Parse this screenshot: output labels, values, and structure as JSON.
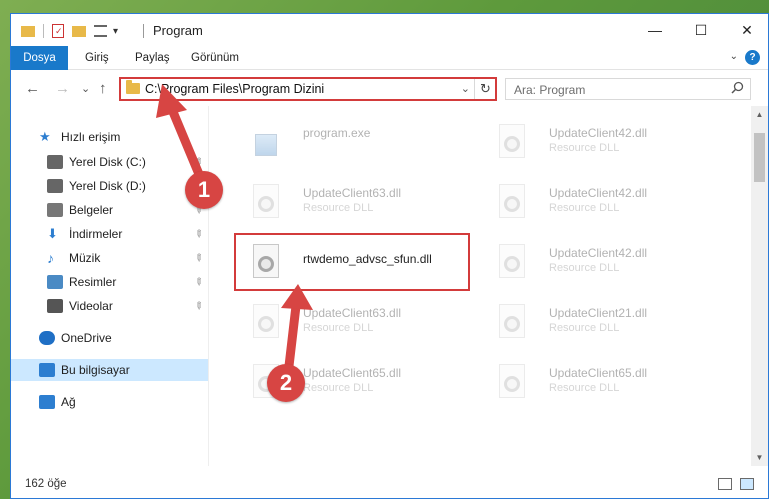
{
  "titlebar": {
    "title": "Program",
    "qa_dropdown": "▾",
    "minimize": "—",
    "maximize": "☐",
    "close": "✕"
  },
  "ribbon": {
    "tabs": [
      "Dosya",
      "Giriş",
      "Paylaş",
      "Görünüm"
    ],
    "expand": "⌄",
    "help": "?"
  },
  "nav": {
    "back": "←",
    "forward": "→",
    "recent": "⌄",
    "up": "↑"
  },
  "address": {
    "path": "C:\\Program Files\\Program Dizini",
    "dropdown": "⌄",
    "refresh": "↻"
  },
  "search": {
    "placeholder": "Ara: Program",
    "icon": "search-icon"
  },
  "sidebar": {
    "items": [
      {
        "label": "Hızlı erişim",
        "icon": "star-icon",
        "pinned": false
      },
      {
        "label": "Yerel Disk (C:)",
        "icon": "drive-icon",
        "pinned": true
      },
      {
        "label": "Yerel Disk (D:)",
        "icon": "drive-icon",
        "pinned": true
      },
      {
        "label": "Belgeler",
        "icon": "documents-icon",
        "pinned": true
      },
      {
        "label": "İndirmeler",
        "icon": "download-icon",
        "pinned": true
      },
      {
        "label": "Müzik",
        "icon": "music-icon",
        "pinned": true
      },
      {
        "label": "Resimler",
        "icon": "pictures-icon",
        "pinned": true
      },
      {
        "label": "Videolar",
        "icon": "videos-icon",
        "pinned": true
      },
      {
        "label": "OneDrive",
        "icon": "cloud-icon",
        "pinned": false
      },
      {
        "label": "Bu bilgisayar",
        "icon": "computer-icon",
        "pinned": false
      },
      {
        "label": "Ağ",
        "icon": "network-icon",
        "pinned": false
      }
    ],
    "pin_glyph": "📌"
  },
  "files": {
    "left": [
      {
        "name": "program.exe",
        "desc": ""
      },
      {
        "name": "UpdateClient63.dll",
        "desc": "Resource DLL"
      },
      {
        "name": "rtwdemo_advsc_sfun.dll",
        "desc": ""
      },
      {
        "name": "UpdateClient63.dll",
        "desc": "Resource DLL"
      },
      {
        "name": "UpdateClient65.dll",
        "desc": "Resource DLL"
      }
    ],
    "right": [
      {
        "name": "UpdateClient42.dll",
        "desc": "Resource DLL"
      },
      {
        "name": "UpdateClient42.dll",
        "desc": "Resource DLL"
      },
      {
        "name": "UpdateClient42.dll",
        "desc": "Resource DLL"
      },
      {
        "name": "UpdateClient21.dll",
        "desc": "Resource DLL"
      },
      {
        "name": "UpdateClient65.dll",
        "desc": "Resource DLL"
      }
    ]
  },
  "status": {
    "count": "162 öğe"
  },
  "annotations": {
    "step1": "1",
    "step2": "2",
    "color": "#d74543"
  }
}
